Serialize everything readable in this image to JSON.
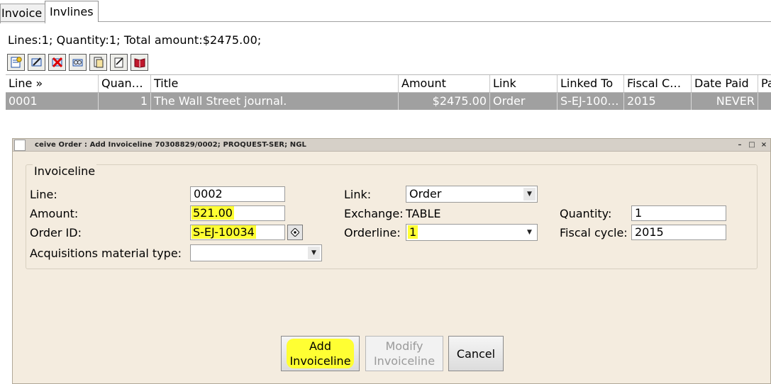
{
  "tabs": [
    {
      "label": "Invoice",
      "active": false
    },
    {
      "label": "Invlines",
      "active": true
    }
  ],
  "summary": "Lines:1; Quantity:1; Total amount:$2475.00;",
  "toolbar": {
    "icons": [
      "add-line-icon",
      "edit-line-icon",
      "delete-line-icon",
      "link-order-icon",
      "copy-icon",
      "notes-icon",
      "book-icon"
    ]
  },
  "grid": {
    "columns": [
      "Line »",
      "Quan…",
      "Title",
      "Amount",
      "Link",
      "Linked To",
      "Fiscal C…",
      "Date Paid",
      "Pa"
    ],
    "rows": [
      {
        "line": "0001",
        "quantity": "1",
        "title": "The Wall Street journal.",
        "amount": "$2475.00",
        "link": "Order",
        "linked_to": "S-EJ-100…",
        "fiscal": "2015",
        "date_paid": "NEVER"
      }
    ]
  },
  "dialog": {
    "title": "ceive Order : Add Invoiceline  70308829/0002; PROQUEST-SER; NGL",
    "controls": [
      "–",
      "□",
      "×"
    ],
    "group_label": "Invoiceline",
    "fields": {
      "line_label": "Line:",
      "line_value": "0002",
      "amount_label": "Amount:",
      "amount_value": "521.00",
      "order_id_label": "Order ID:",
      "order_id_value": "S-EJ-10034",
      "acq_label": "Acquisitions material type:",
      "acq_value": "",
      "link_label": "Link:",
      "link_value": "Order",
      "exchange_label": "Exchange:",
      "exchange_value": "TABLE",
      "orderline_label": "Orderline:",
      "orderline_value": "1",
      "quantity_label": "Quantity:",
      "quantity_value": "1",
      "fiscal_label": "Fiscal cycle:",
      "fiscal_value": "2015"
    },
    "buttons": {
      "add_line1": "Add",
      "add_line2": "Invoiceline",
      "modify_line1": "Modify",
      "modify_line2": "Invoiceline",
      "cancel": "Cancel"
    }
  },
  "colors": {
    "highlight": "#ffff33",
    "dialog_bg": "#f4ecdf",
    "selected_row": "#a0a0a0"
  }
}
